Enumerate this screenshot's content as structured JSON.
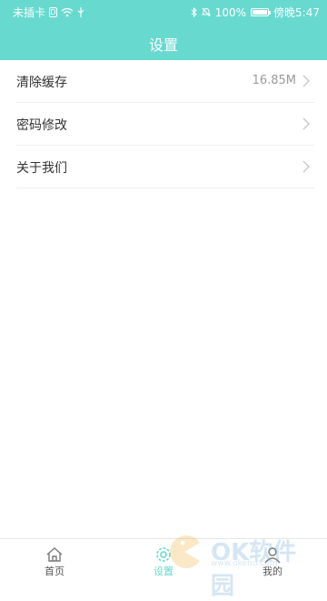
{
  "status_bar": {
    "carrier": "未插卡",
    "battery": "100%",
    "time_label": "傍晚5:47",
    "battery_level": 1.0
  },
  "header": {
    "title": "设置"
  },
  "settings": [
    {
      "label": "清除缓存",
      "value": "16.85M"
    },
    {
      "label": "密码修改"
    },
    {
      "label": "关于我们"
    }
  ],
  "tabbar": {
    "items": [
      {
        "label": "首页",
        "icon": "home-icon"
      },
      {
        "label": "设置",
        "icon": "settings-gear-icon",
        "active": true
      },
      {
        "label": "我的",
        "icon": "user-icon"
      }
    ]
  },
  "watermark": {
    "text": "OK软件园",
    "url": "www.okehu.com"
  },
  "colors": {
    "accent": "#68d9cf",
    "divider": "#eeeeee",
    "muted": "#9a9a9a"
  }
}
